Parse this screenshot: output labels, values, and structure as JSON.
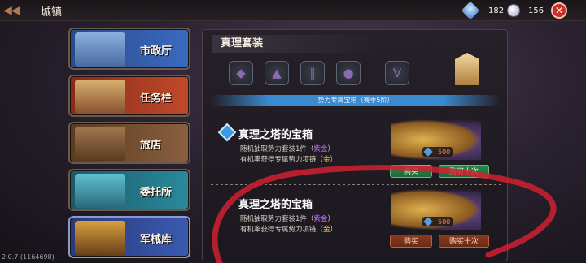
{
  "header": {
    "title": "城镇",
    "currency": [
      {
        "icon": "gem-icon",
        "value": "182"
      },
      {
        "icon": "coin-icon",
        "value": "156"
      }
    ]
  },
  "sidebar": {
    "items": [
      {
        "label": "市政厅"
      },
      {
        "label": "任务栏"
      },
      {
        "label": "旅店"
      },
      {
        "label": "委托所"
      },
      {
        "label": "军械库",
        "selected": true
      }
    ]
  },
  "version": "2.0.7 (1164698)",
  "panel": {
    "title": "真理套装",
    "gear_icons": [
      "necklace-icon",
      "robe-icon",
      "boots-icon",
      "helmet-icon",
      "horned-helm-icon"
    ],
    "banner": "势力专属宝箱（赛季5阶）",
    "chests": [
      {
        "title": "真理之塔的宝箱",
        "desc1_prefix": "随机抽取势力套装1件（",
        "desc1_hl": "紫金",
        "desc1_suffix": "）",
        "desc2_prefix": "有机率获得专属势力项链（",
        "desc2_hl": "金",
        "desc2_suffix": "）",
        "price": "500",
        "buy_label": "购买",
        "buy10_label": "购买十次"
      },
      {
        "title": "真理之塔的宝箱",
        "desc1_prefix": "随机抽取势力套装1件（",
        "desc1_hl": "紫金",
        "desc1_suffix": "）",
        "desc2_prefix": "有机率获得专属势力项链（",
        "desc2_hl": "金",
        "desc2_suffix": "）",
        "price": "500",
        "buy_label": "购买",
        "buy10_label": "购买十次"
      }
    ]
  },
  "colors": {
    "annotation": "#d02030",
    "highlight_purple": "#c070ff",
    "highlight_gold": "#f0c040"
  }
}
